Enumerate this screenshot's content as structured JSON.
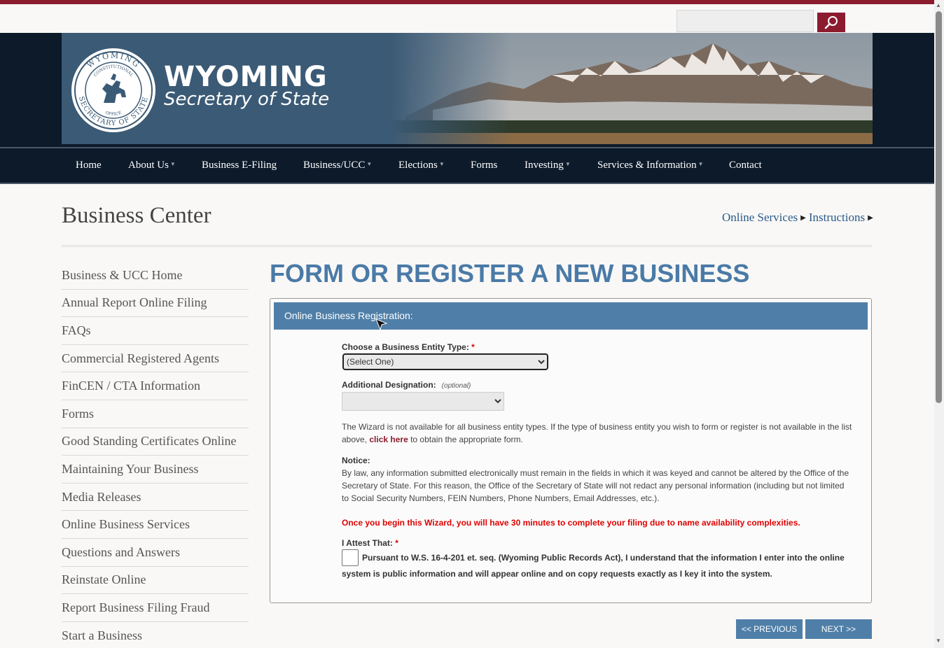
{
  "header": {
    "search_placeholder": "",
    "brand_title": "WYOMING",
    "brand_subtitle": "Secretary of State",
    "seal": {
      "ring_top": "WYOMING",
      "ring_bottom": "SECRETARY OF STATE",
      "inner_top": "CONSTITUTIONAL",
      "inner_bottom": "OFFICE"
    }
  },
  "nav": {
    "items": [
      {
        "label": "Home"
      },
      {
        "label": "About Us"
      },
      {
        "label": "Business E-Filing"
      },
      {
        "label": "Business/UCC"
      },
      {
        "label": "Elections"
      },
      {
        "label": "Forms"
      },
      {
        "label": "Investing"
      },
      {
        "label": "Services & Information"
      },
      {
        "label": "Contact"
      }
    ],
    "caret": "▼"
  },
  "page": {
    "title": "Business Center",
    "breadcrumb": [
      "Online Services",
      "Instructions"
    ],
    "breadcrumb_arrow": "▶"
  },
  "sidebar": {
    "items": [
      "Business & UCC Home",
      "Annual Report Online Filing",
      "FAQs",
      "Commercial Registered Agents",
      "FinCEN / CTA Information",
      "Forms",
      "Good Standing Certificates Online",
      "Maintaining Your Business",
      "Media Releases",
      "Online Business Services",
      "Questions and Answers",
      "Reinstate Online",
      "Report Business Filing Fraud",
      "Start a Business"
    ]
  },
  "main": {
    "title": "FORM OR REGISTER A NEW BUSINESS",
    "panel_title": "Online Business Registration:",
    "entity_type_label": "Choose a Business Entity Type:",
    "required_mark": "*",
    "entity_type_value": "(Select One)",
    "designation_label": "Additional Designation:",
    "designation_optional": "(optional)",
    "designation_value": "",
    "wizard_text_1": "The Wizard is not available for all business entity types. If the type of business entity you wish to form or register is not available in the list above,",
    "wizard_link": "click here",
    "wizard_text_2": "to obtain the appropriate form.",
    "notice_label": "Notice:",
    "notice_text": "By law, any information submitted electronically must remain in the fields in which it was keyed and cannot be altered by the Office of the Secretary of State. For this reason, the Office of the Secretary of State will not redact any personal information (including but not limited to Social Security Numbers, FEIN Numbers, Phone Numbers, Email Addresses, etc.).",
    "warning_text": "Once you begin this Wizard, you will have 30 minutes to complete your filing due to name availability complexities.",
    "attest_label": "I Attest That:",
    "attest_text": "Pursuant to W.S. 16-4-201 et. seq. (Wyoming Public Records Act), I understand that the information I enter into the online system is public information and will appear online and on copy requests exactly as I key it into the system.",
    "prev_button": "<< PREVIOUS",
    "next_button": "NEXT >>"
  },
  "colors": {
    "brand_red": "#8a1c2e",
    "nav_bg": "#0c1a2a",
    "panel_blue": "#4f7fa8",
    "title_blue": "#4a7aa7",
    "warning_red": "#e00000"
  }
}
